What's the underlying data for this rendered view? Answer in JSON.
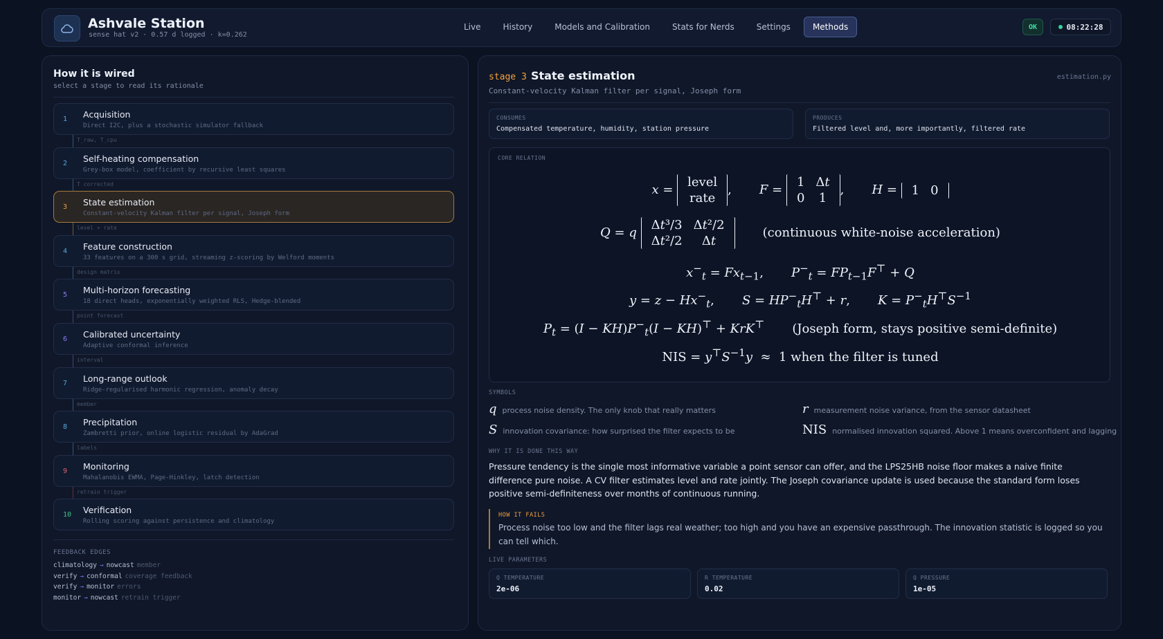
{
  "app": {
    "title": "Ashvale Station",
    "subtitle": "sense hat v2 · 0.57 d logged · k=0.262"
  },
  "nav": {
    "tabs": [
      {
        "label": "Live"
      },
      {
        "label": "History"
      },
      {
        "label": "Models and Calibration"
      },
      {
        "label": "Stats for Nerds"
      },
      {
        "label": "Settings"
      },
      {
        "label": "Methods",
        "active": true
      }
    ]
  },
  "status": {
    "badge": "OK",
    "clock": "08:22:28"
  },
  "left": {
    "title": "How it is wired",
    "subtitle": "select a stage to read its rationale",
    "stages": [
      {
        "num": "1",
        "title": "Acquisition",
        "desc": "Direct I2C, plus a stochastic simulator fallback",
        "color": "#5aa8d8"
      },
      {
        "num": "2",
        "title": "Self-heating compensation",
        "desc": "Grey-box model, coefficient by recursive least squares",
        "color": "#5aa8d8"
      },
      {
        "num": "3",
        "title": "State estimation",
        "desc": "Constant-velocity Kalman filter per signal, Joseph form",
        "color": "#f0a040",
        "active": true
      },
      {
        "num": "4",
        "title": "Feature construction",
        "desc": "33 features on a 300 s grid, streaming z-scoring by Welford moments",
        "color": "#5aa8d8"
      },
      {
        "num": "5",
        "title": "Multi-horizon forecasting",
        "desc": "18 direct heads, exponentially weighted RLS, Hedge-blended",
        "color": "#8a7cf0"
      },
      {
        "num": "6",
        "title": "Calibrated uncertainty",
        "desc": "Adaptive conformal inference",
        "color": "#8a7cf0"
      },
      {
        "num": "7",
        "title": "Long-range outlook",
        "desc": "Ridge-regularised harmonic regression, anomaly decay",
        "color": "#5aa8d8"
      },
      {
        "num": "8",
        "title": "Precipitation",
        "desc": "Zambretti prior, online logistic residual by AdaGrad",
        "color": "#5aa8d8"
      },
      {
        "num": "9",
        "title": "Monitoring",
        "desc": "Mahalanobis EWMA, Page-Hinkley, latch detection",
        "color": "#e06070"
      },
      {
        "num": "10",
        "title": "Verification",
        "desc": "Rolling scoring against persistence and climatology",
        "color": "#40c080"
      }
    ],
    "connectors": [
      {
        "label": "T_raw, T_cpu",
        "color": "#2e5a7a"
      },
      {
        "label": "T corrected",
        "color": "#2e5a7a"
      },
      {
        "label": "level + rate",
        "color": "#7a5a2e"
      },
      {
        "label": "design matrix",
        "color": "#2e5a7a"
      },
      {
        "label": "point forecast",
        "color": "#4a427a"
      },
      {
        "label": "interval",
        "color": "#4a427a"
      },
      {
        "label": "member",
        "color": "#2e5a7a"
      },
      {
        "label": "labels",
        "color": "#2e5a7a"
      },
      {
        "label": "retrain trigger",
        "color": "#6a2e3a"
      }
    ],
    "feedback_title": "FEEDBACK EDGES",
    "feedback": [
      {
        "from": "climatology",
        "to": "nowcast",
        "note": "member"
      },
      {
        "from": "verify",
        "to": "conformal",
        "note": "coverage feedback"
      },
      {
        "from": "verify",
        "to": "monitor",
        "note": "errors"
      },
      {
        "from": "monitor",
        "to": "nowcast",
        "note": "retrain trigger"
      }
    ]
  },
  "detail": {
    "stage_tag": "stage 3",
    "title": "State estimation",
    "file": "estimation.py",
    "subtitle": "Constant-velocity Kalman filter per signal, Joseph form",
    "consumes_label": "CONSUMES",
    "consumes": "Compensated temperature, humidity, station pressure",
    "produces_label": "PRODUCES",
    "produces": "Filtered level and, more importantly, filtered rate",
    "core_label": "CORE RELATION",
    "eq_note_q": "(continuous white-noise acceleration)",
    "eq_note_joseph": "(Joseph form, stays positive semi-definite)",
    "eq_nis_text": "1 when the filter is tuned",
    "symbols_label": "SYMBOLS",
    "symbols": [
      {
        "key": "q",
        "desc": "process noise density. The only knob that really matters"
      },
      {
        "key": "r",
        "desc": "measurement noise variance, from the sensor datasheet"
      },
      {
        "key": "S",
        "desc": "innovation covariance: how surprised the filter expects to be"
      },
      {
        "key": "NIS",
        "desc": "normalised innovation squared. Above 1 means overconfident and lagging"
      }
    ],
    "why_label": "WHY IT IS DONE THIS WAY",
    "why": "Pressure tendency is the single most informative variable a point sensor can offer, and the LPS25HB noise floor makes a naive finite difference pure noise. A CV filter estimates level and rate jointly. The Joseph covariance update is used because the standard form loses positive semi-definiteness over months of continuous running.",
    "fails_label": "HOW IT FAILS",
    "fails": "Process noise too low and the filter lags real weather; too high and you have an expensive passthrough. The innovation statistic is logged so you can tell which.",
    "params_label": "LIVE PARAMETERS",
    "params": [
      {
        "label": "Q TEMPERATURE",
        "value": "2e-06"
      },
      {
        "label": "R TEMPERATURE",
        "value": "0.02"
      },
      {
        "label": "Q PRESSURE",
        "value": "1e-05"
      }
    ]
  }
}
